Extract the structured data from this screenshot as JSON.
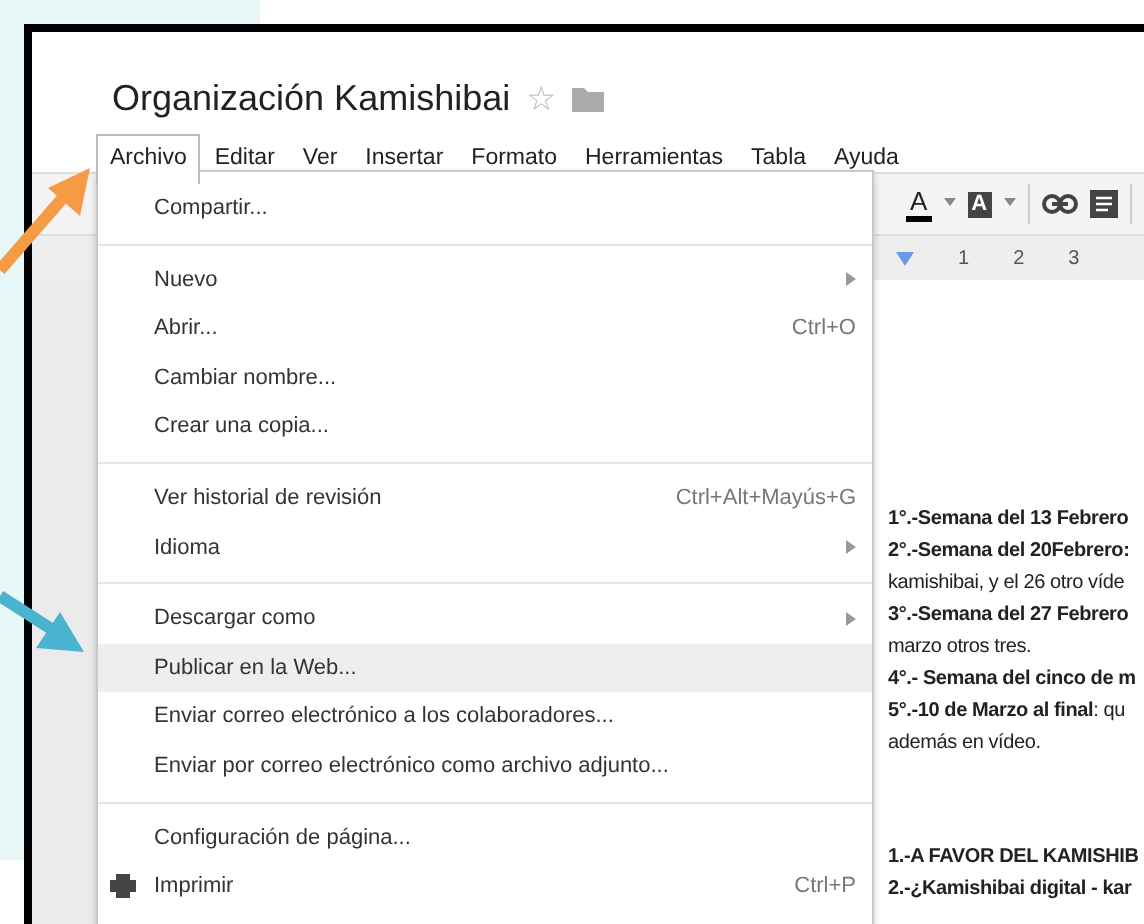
{
  "document": {
    "title": "Organización Kamishibai",
    "star_glyph": "☆",
    "starred": false
  },
  "menubar": [
    {
      "label": "Archivo",
      "selected": true
    },
    {
      "label": "Editar",
      "selected": false
    },
    {
      "label": "Ver",
      "selected": false
    },
    {
      "label": "Insertar",
      "selected": false
    },
    {
      "label": "Formato",
      "selected": false
    },
    {
      "label": "Herramientas",
      "selected": false
    },
    {
      "label": "Tabla",
      "selected": false
    },
    {
      "label": "Ayuda",
      "selected": false
    }
  ],
  "toolbar": {
    "text_color_glyph": "A",
    "highlight_glyph": "A"
  },
  "ruler": {
    "labels": [
      "1",
      "2",
      "3"
    ]
  },
  "menu": [
    {
      "kind": "item",
      "label": "Compartir...",
      "selected": false
    },
    {
      "kind": "separator"
    },
    {
      "kind": "item",
      "label": "Nuevo",
      "submenu": true,
      "selected": false
    },
    {
      "kind": "item",
      "label": "Abrir...",
      "shortcut": "Ctrl+O",
      "selected": false
    },
    {
      "kind": "item",
      "label": "Cambiar nombre...",
      "selected": false
    },
    {
      "kind": "item",
      "label": "Crear una copia...",
      "selected": false
    },
    {
      "kind": "separator"
    },
    {
      "kind": "item",
      "label": "Ver historial de revisión",
      "shortcut": "Ctrl+Alt+Mayús+G",
      "selected": false
    },
    {
      "kind": "item",
      "label": "Idioma",
      "submenu": true,
      "selected": false
    },
    {
      "kind": "separator"
    },
    {
      "kind": "item",
      "label": "Descargar como",
      "submenu": true,
      "selected": false
    },
    {
      "kind": "item",
      "label": "Publicar en la Web...",
      "selected": true
    },
    {
      "kind": "item",
      "label": "Enviar correo electrónico a los colaboradores...",
      "selected": false
    },
    {
      "kind": "item",
      "label": "Enviar por correo electrónico como archivo adjunto...",
      "selected": false
    },
    {
      "kind": "separator"
    },
    {
      "kind": "item",
      "label": "Configuración de página...",
      "selected": false
    },
    {
      "kind": "item",
      "label": "Imprimir",
      "shortcut": "Ctrl+P",
      "has_icon": true,
      "selected": false
    }
  ],
  "body": [
    {
      "kind": "line",
      "text": "**1°.-Semana del 13 Febrero**"
    },
    {
      "kind": "line",
      "text": "**2°.-Semana del 20Febrero:**"
    },
    {
      "kind": "line",
      "text": "kamishibai, y el 26 otro víde"
    },
    {
      "kind": "line",
      "text": "**3°.-Semana del 27 Febrero**"
    },
    {
      "kind": "line",
      "text": "marzo otros tres."
    },
    {
      "kind": "line",
      "text": "**4°.- Semana del cinco de m**"
    },
    {
      "kind": "line",
      "text": "**5°.-10 de Marzo al final**: qu"
    },
    {
      "kind": "line",
      "text": "además en vídeo."
    },
    {
      "kind": "gap"
    },
    {
      "kind": "line",
      "text": "**1.-A FAVOR DEL KAMISHIB**"
    },
    {
      "kind": "line",
      "text": "**2.-¿Kamishibai digital - kar**"
    }
  ]
}
